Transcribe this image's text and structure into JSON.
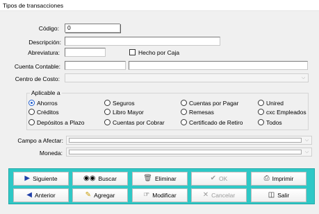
{
  "window": {
    "title": "Tipos de transacciones"
  },
  "form": {
    "codigo": {
      "label": "Código:",
      "value": "0"
    },
    "descripcion": {
      "label": "Descripción:",
      "value": ""
    },
    "abreviatura": {
      "label": "Abreviatura:",
      "value": ""
    },
    "hecho_por_caja": {
      "label": "Hecho por Caja",
      "checked": false
    },
    "cuenta_contable": {
      "label": "Cuenta Contable:",
      "value": "",
      "description": ""
    },
    "centro_costo": {
      "label": "Centro de Costo:",
      "value": ""
    },
    "campo_afectar": {
      "label": "Campo a Afectar:",
      "value": ""
    },
    "moneda": {
      "label": "Moneda:",
      "value": ""
    }
  },
  "aplicable": {
    "legend": "Aplicable a",
    "selected": "Ahorros",
    "options": [
      "Ahorros",
      "Créditos",
      "Depósitos a Plazo",
      "Seguros",
      "Libro Mayor",
      "Cuentas por Cobrar",
      "Cuentas por Pagar",
      "Remesas",
      "Certificado de Retiro",
      "Unired",
      "cxc Empleados",
      "Todos"
    ]
  },
  "buttons": {
    "siguiente": "Siguiente",
    "buscar": "Buscar",
    "eliminar": "Eliminar",
    "ok": "OK",
    "imprimir": "Imprimir",
    "anterior": "Anterior",
    "agregar": "Agregar",
    "modificar": "Modificar",
    "cancelar": "Cancelar",
    "salir": "Salir"
  },
  "icons": {
    "siguiente": "play-right-icon",
    "buscar": "binoculars-icon",
    "eliminar": "trash-icon",
    "ok": "checkmark-icon",
    "imprimir": "printer-icon",
    "anterior": "play-left-icon",
    "agregar": "pencil-icon",
    "modificar": "hand-edit-icon",
    "cancelar": "x-icon",
    "salir": "exit-door-icon"
  },
  "colors": {
    "panel": "#2ec8c6",
    "radio_selected": "#1e5ccc"
  }
}
